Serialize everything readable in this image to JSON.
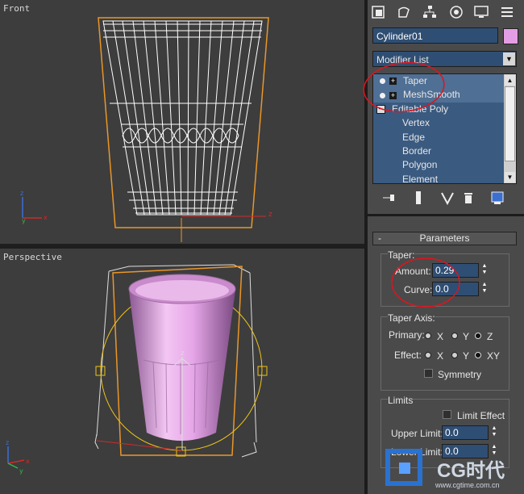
{
  "viewports": {
    "front": {
      "label": "Front"
    },
    "perspective": {
      "label": "Perspective"
    }
  },
  "axis_labels": {
    "x": "x",
    "y": "y",
    "z": "z"
  },
  "command_panel": {
    "tabs": [
      "create-icon",
      "modify-icon",
      "hierarchy-icon",
      "motion-icon",
      "display-icon",
      "utilities-icon"
    ],
    "object_name": "Cylinder01",
    "object_color": "#e39de4",
    "modifier_list_label": "Modifier List",
    "stack": {
      "modifiers": [
        {
          "label": "Taper"
        },
        {
          "label": "MeshSmooth"
        }
      ],
      "base_object": "Editable Poly",
      "sub_objects": [
        "Vertex",
        "Edge",
        "Border",
        "Polygon",
        "Element"
      ]
    },
    "stack_tools": [
      "pin-stack-icon",
      "show-end-result-icon",
      "make-unique-icon",
      "remove-modifier-icon",
      "configure-sets-icon"
    ],
    "parameters": {
      "rollout_sign": "-",
      "rollout_title": "Parameters",
      "taper_group": "Taper:",
      "amount_label": "Amount:",
      "amount_value": "0.29",
      "curve_label": "Curve:",
      "curve_value": "0.0",
      "axis_group": "Taper Axis:",
      "primary_label": "Primary:",
      "effect_label": "Effect:",
      "primary_options": [
        "X",
        "Y",
        "Z"
      ],
      "primary_selected": "Z",
      "effect_options": [
        "X",
        "Y",
        "XY"
      ],
      "effect_selected": "XY",
      "symmetry_label": "Symmetry",
      "limits_group": "Limits",
      "limit_effect_label": "Limit Effect",
      "upper_limit_label": "Upper Limit:",
      "upper_limit_value": "0.0",
      "lower_limit_label": "Lower Limit:",
      "lower_limit_value": "0.0"
    }
  },
  "annotation_color": "#e0141e",
  "watermark": {
    "brand": "CG时代",
    "url": "www.cgtime.com.cn"
  }
}
